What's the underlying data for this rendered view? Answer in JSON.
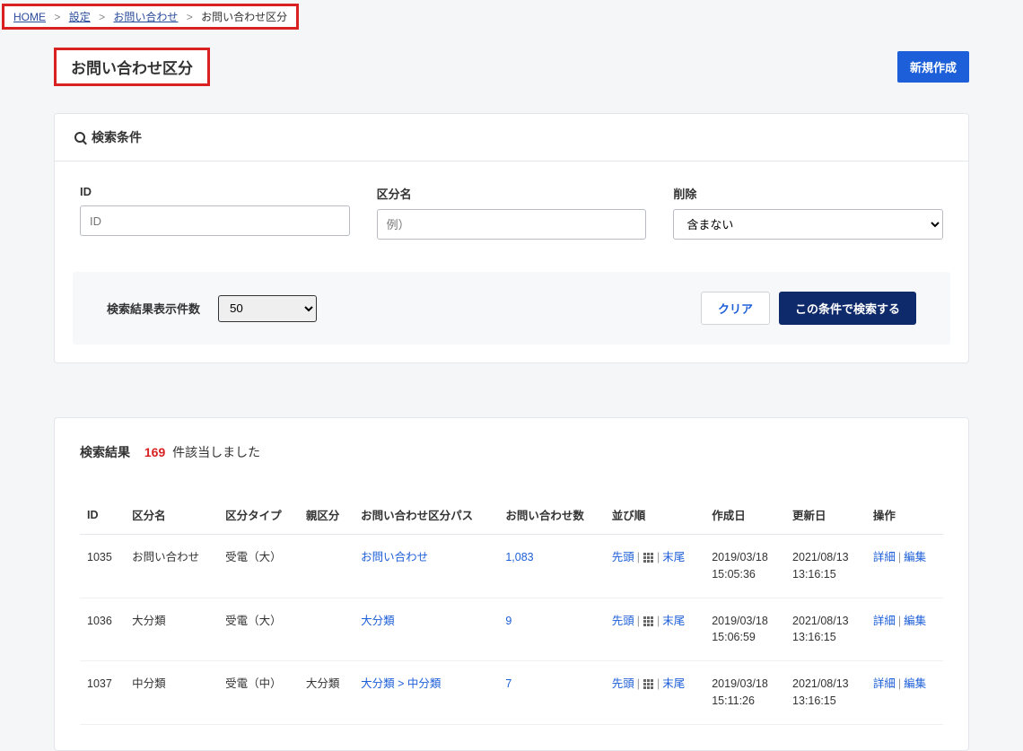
{
  "breadcrumb": {
    "items": [
      "HOME",
      "設定",
      "お問い合わせ"
    ],
    "current": "お問い合わせ区分"
  },
  "page": {
    "title": "お問い合わせ区分",
    "new_button": "新規作成"
  },
  "search": {
    "header": "検索条件",
    "id_label": "ID",
    "id_placeholder": "ID",
    "name_label": "区分名",
    "name_placeholder": "例）",
    "delete_label": "削除",
    "delete_selected": "含まない",
    "per_page_label": "検索結果表示件数",
    "per_page_value": "50",
    "clear_button": "クリア",
    "submit_button": "この条件で検索する"
  },
  "results": {
    "label": "検索結果",
    "count": "169",
    "suffix": "件該当しました",
    "columns": [
      "ID",
      "区分名",
      "区分タイプ",
      "親区分",
      "お問い合わせ区分パス",
      "お問い合わせ数",
      "並び順",
      "作成日",
      "更新日",
      "操作"
    ],
    "order": {
      "head": "先頭",
      "tail": "末尾"
    },
    "actions": {
      "detail": "詳細",
      "edit": "編集"
    },
    "rows": [
      {
        "id": "1035",
        "name": "お問い合わせ",
        "type": "受電（大）",
        "parent": "",
        "path": "お問い合わせ",
        "inquiries": "1,083",
        "created": "2019/03/18 15:05:36",
        "updated": "2021/08/13 13:16:15"
      },
      {
        "id": "1036",
        "name": "大分類",
        "type": "受電（大）",
        "parent": "",
        "path": "大分類",
        "inquiries": "9",
        "created": "2019/03/18 15:06:59",
        "updated": "2021/08/13 13:16:15"
      },
      {
        "id": "1037",
        "name": "中分類",
        "type": "受電（中）",
        "parent": "大分類",
        "path": "大分類 > 中分類",
        "inquiries": "7",
        "created": "2019/03/18 15:11:26",
        "updated": "2021/08/13 13:16:15"
      }
    ]
  }
}
